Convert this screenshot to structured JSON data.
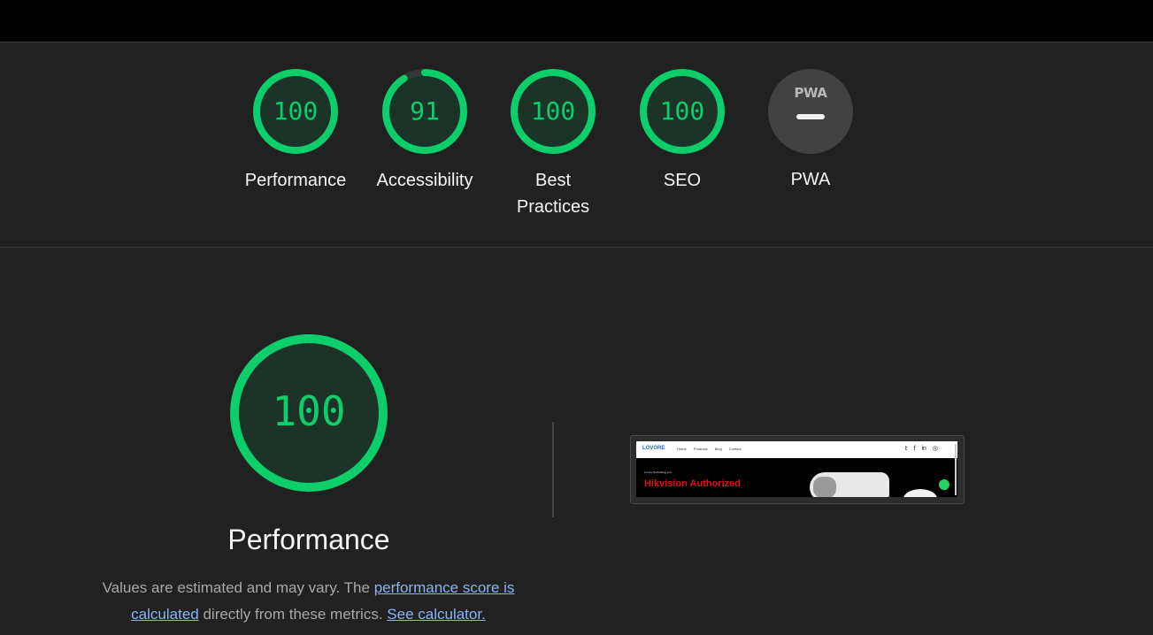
{
  "categories": [
    {
      "name": "Performance",
      "score": "100",
      "value": 100
    },
    {
      "name": "Accessibility",
      "score": "91",
      "value": 91
    },
    {
      "name": "Best Practices",
      "score": "100",
      "value": 100
    },
    {
      "name": "SEO",
      "score": "100",
      "value": 100
    }
  ],
  "pwa": {
    "label": "PWA",
    "logo_text": "PWA"
  },
  "main": {
    "score": "100",
    "title": "Performance",
    "desc_prefix": "Values are estimated and may vary. The ",
    "desc_link1": "performance score is calculated",
    "desc_middle": " directly from these metrics. ",
    "desc_link2": "See calculator."
  },
  "screenshot": {
    "logo": "LOVORE",
    "nav": "Home Products Blog Contact",
    "social": "𝕥 f in ◎",
    "company": "Lovore Technology LLC",
    "headline": "Hikvision Authorized"
  },
  "colors": {
    "pass": "#0cce6b",
    "pass_fill": "#1b3427",
    "average": "#ffa400"
  }
}
